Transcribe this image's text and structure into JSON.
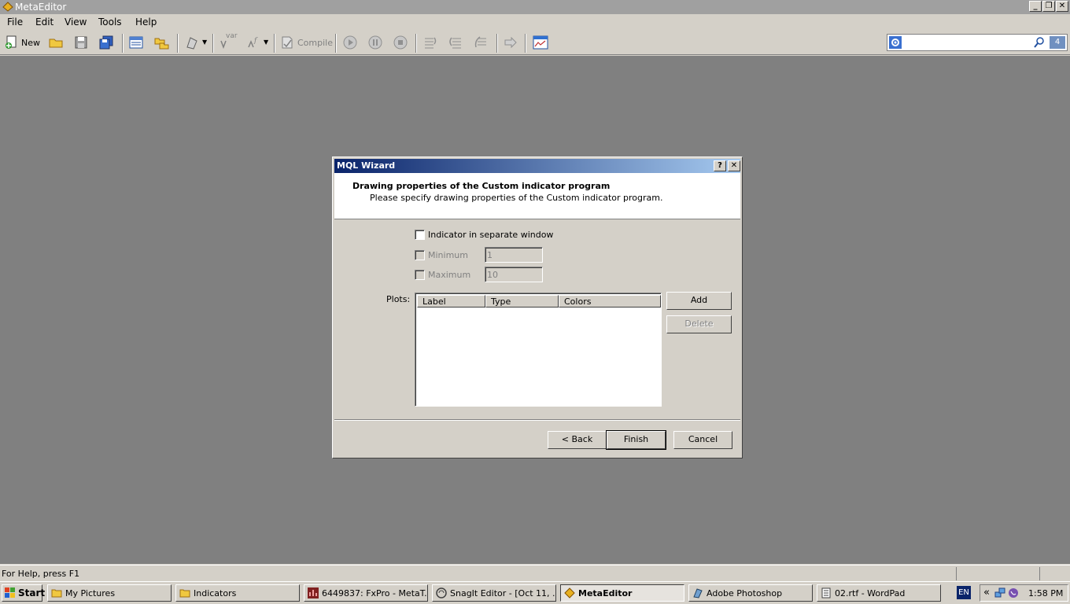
{
  "app": {
    "title": "MetaEditor",
    "window_buttons": [
      "_",
      "❐",
      "✕"
    ]
  },
  "menu": {
    "items": [
      "File",
      "Edit",
      "View",
      "Tools",
      "Help"
    ]
  },
  "toolbar": {
    "new_label": "New",
    "var_label": "var",
    "compile_label": "Compile",
    "search_badge": "4",
    "icons": [
      "new-icon",
      "open-folder-icon",
      "save-icon",
      "save-all-icon",
      "navigator-icon",
      "toolbox-icon",
      "styler-icon",
      "var-icon",
      "function-icon",
      "compile-icon",
      "play-icon",
      "pause-icon",
      "stop-icon",
      "step-into-icon",
      "step-over-icon",
      "step-out-icon",
      "arrow-right-icon",
      "terminal-icon",
      "settings-icon",
      "search-icon"
    ]
  },
  "dialog": {
    "title": "MQL Wizard",
    "help_btn": "?",
    "close_btn": "✕",
    "heading": "Drawing properties of the Custom indicator program",
    "subheading": "Please specify drawing properties of the Custom indicator program.",
    "separate_window_label": "Indicator in separate window",
    "minimum_label": "Minimum",
    "minimum_value": "1",
    "maximum_label": "Maximum",
    "maximum_value": "10",
    "plots_label": "Plots:",
    "columns": [
      "Label",
      "Type",
      "Colors"
    ],
    "add_label": "Add",
    "delete_label": "Delete",
    "back_label": "< Back",
    "finish_label": "Finish",
    "cancel_label": "Cancel"
  },
  "statusbar": {
    "text": "For Help, press F1"
  },
  "taskbar": {
    "start_label": "Start",
    "tasks": [
      {
        "label": "My Pictures",
        "icon": "folder-icon"
      },
      {
        "label": "Indicators",
        "icon": "folder-icon"
      },
      {
        "label": "6449837: FxPro - MetaT...",
        "icon": "metatrader-icon"
      },
      {
        "label": "SnagIt Editor - [Oct 11, ...",
        "icon": "snagit-icon"
      },
      {
        "label": "MetaEditor",
        "icon": "metaeditor-icon"
      },
      {
        "label": "Adobe Photoshop",
        "icon": "photoshop-icon"
      },
      {
        "label": "02.rtf - WordPad",
        "icon": "wordpad-icon"
      }
    ],
    "lang": "EN",
    "tray_chevron": "«",
    "clock": "1:58 PM"
  }
}
